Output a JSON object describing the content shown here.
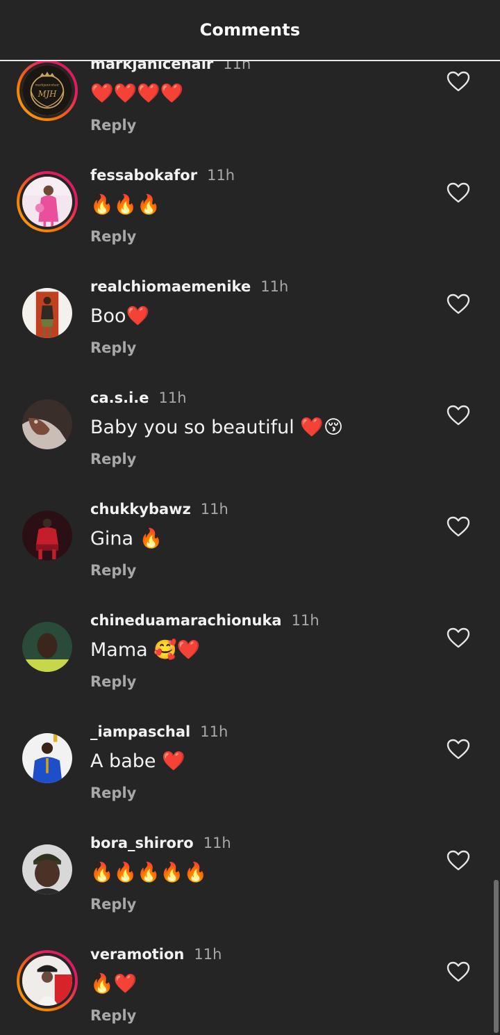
{
  "header": {
    "title": "Comments"
  },
  "comments": [
    {
      "username": "markjanicehair",
      "time": "11h",
      "text": "❤️❤️❤️❤️",
      "reply": "Reply",
      "avatar_logo_text": "MJH",
      "avatar_logo_caption": "markjanicehair"
    },
    {
      "username": "fessabokafor",
      "time": "11h",
      "text": "🔥🔥🔥",
      "reply": "Reply"
    },
    {
      "username": "realchiomaemenike",
      "time": "11h",
      "text": "Boo❤️",
      "reply": "Reply"
    },
    {
      "username": "ca.s.i.e",
      "time": "11h",
      "text": "Baby you so beautiful ❤️😚",
      "reply": "Reply"
    },
    {
      "username": "chukkybawz",
      "time": "11h",
      "text": "Gina 🔥",
      "reply": "Reply"
    },
    {
      "username": "chineduamarachionuka",
      "time": "11h",
      "text": "Mama 🥰❤️",
      "reply": "Reply"
    },
    {
      "username": "_iampaschal",
      "time": "11h",
      "text": "A babe ❤️",
      "reply": "Reply"
    },
    {
      "username": "bora_shiroro",
      "time": "11h",
      "text": "🔥🔥🔥🔥🔥",
      "reply": "Reply"
    },
    {
      "username": "veramotion",
      "time": "11h",
      "text": "🔥❤️",
      "reply": "Reply"
    }
  ],
  "icons": {
    "like": "heart-outline-icon"
  },
  "colors": {
    "background": "#252525",
    "text": "#f2f2f2",
    "secondary": "#a8a8a8",
    "story_ring_start": "#f9a825",
    "story_ring_end": "#c2185b"
  }
}
